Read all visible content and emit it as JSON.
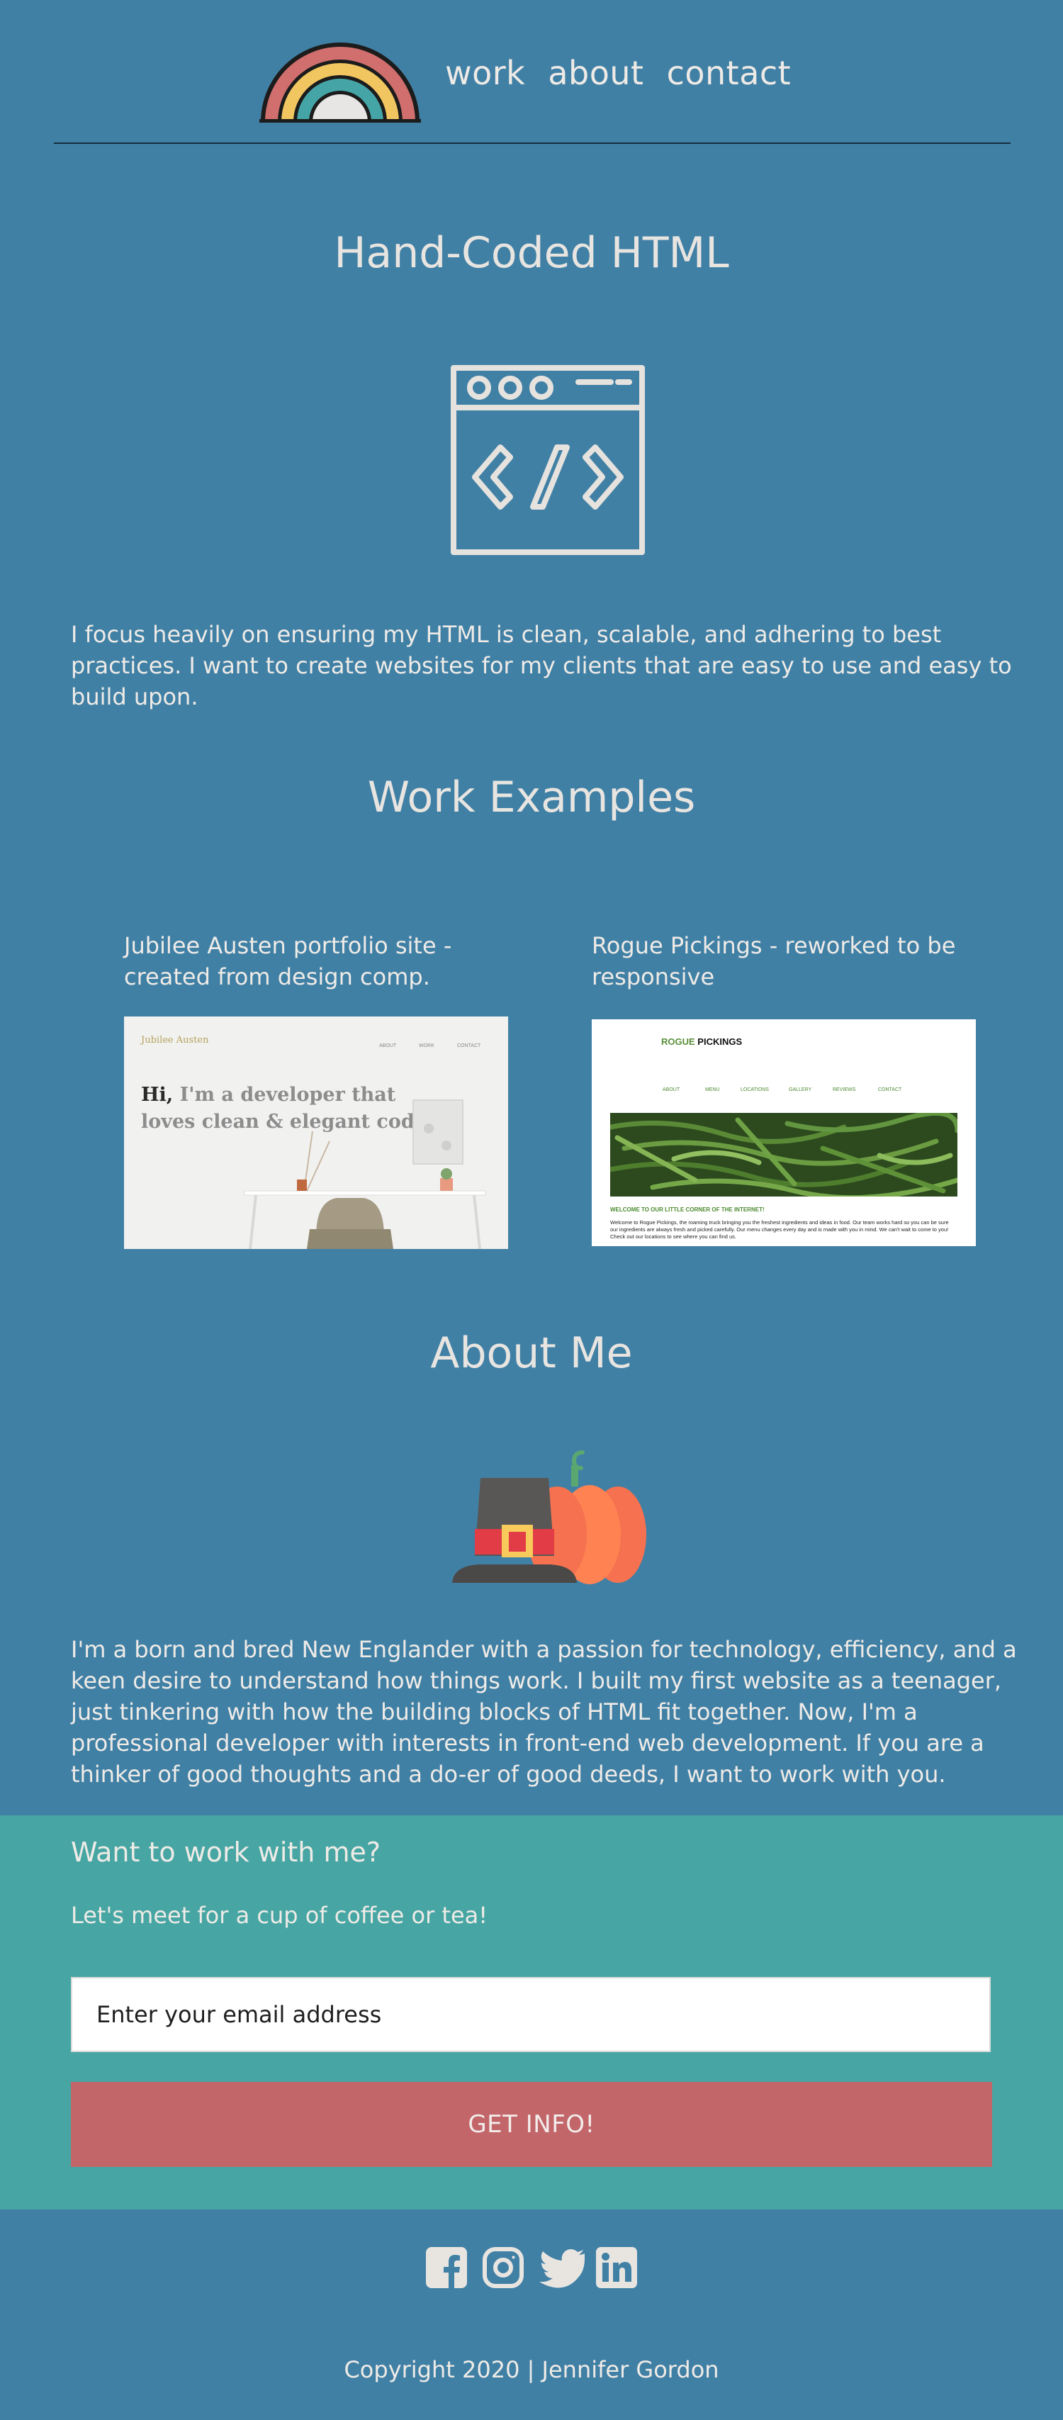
{
  "nav": {
    "work": "work",
    "about": "about",
    "contact": "contact"
  },
  "section_html": {
    "title": "Hand-Coded HTML",
    "body": "I focus heavily on ensuring my HTML is clean, scalable, and adhering to best practices. I want to create websites for my clients that are easy to use and easy to build upon."
  },
  "work": {
    "title": "Work Examples",
    "items": [
      {
        "title": "Jubilee Austen portfolio site - created from design comp.",
        "mock": {
          "brand": "Jubilee Austen",
          "nav": [
            "ABOUT",
            "WORK",
            "CONTACT"
          ],
          "hero_bold": "Hi,",
          "hero_rest": " I'm a developer that loves clean & elegant code."
        }
      },
      {
        "title": "Rogue Pickings - reworked to be responsive",
        "mock": {
          "brand_accent": "ROGUE",
          "brand_rest": " PICKINGS",
          "nav": [
            "ABOUT",
            "MENU",
            "LOCATIONS",
            "GALLERY",
            "REVIEWS",
            "CONTACT"
          ],
          "welcome": "WELCOME TO OUR LITTLE CORNER OF THE INTERNET!",
          "blurb": "Welcome to Rogue Pickings, the roaming truck bringing you the freshest ingredients and ideas in food. Our team works hard so you can be sure our ingredients are always fresh and picked carefully. Our menu changes every day and is made with you in mind. We can't wait to come to you! Check out our locations to see where you can find us."
        }
      }
    ]
  },
  "about": {
    "title": "About Me",
    "body": "I'm a born and bred New Englander with a passion for technology, efficiency, and a keen desire to understand how things work. I built my first website as a teenager, just tinkering with how the building blocks of HTML fit together. Now, I'm a professional developer with interests in front-end web development. If you are a thinker of good thoughts and a do-er of good deeds, I want to work with you."
  },
  "cta": {
    "heading": "Want to work with me?",
    "subheading": "Let's meet for a cup of coffee or tea!",
    "email_placeholder": "Enter your email address",
    "button": "GET INFO!"
  },
  "footer": {
    "social_icons": [
      "facebook-icon",
      "instagram-icon",
      "twitter-icon",
      "linkedin-icon"
    ],
    "copyright": "Copyright 2020 | Jennifer Gordon"
  },
  "colors": {
    "background": "#4180a5",
    "cta_background": "#47a6a3",
    "button": "#c2666a",
    "text": "#e8e5e1"
  }
}
